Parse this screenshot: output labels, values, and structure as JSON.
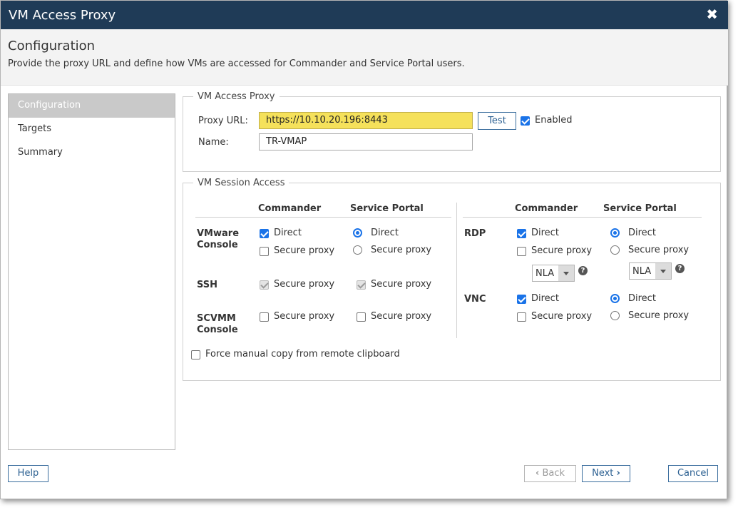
{
  "window": {
    "title": "VM Access Proxy",
    "close_icon": "✖"
  },
  "header": {
    "title": "Configuration",
    "description": "Provide the proxy URL and define how VMs are accessed for Commander and Service Portal users."
  },
  "nav": {
    "items": [
      {
        "label": "Configuration",
        "active": true
      },
      {
        "label": "Targets",
        "active": false
      },
      {
        "label": "Summary",
        "active": false
      }
    ]
  },
  "proxy": {
    "legend": "VM Access Proxy",
    "url_label": "Proxy URL:",
    "url_value": "https://10.10.20.196:8443",
    "test_label": "Test",
    "enabled_label": "Enabled",
    "enabled_checked": true,
    "name_label": "Name:",
    "name_value": "TR-VMAP"
  },
  "session": {
    "legend": "VM Session Access",
    "left": {
      "col_commander": "Commander",
      "col_portal": "Service Portal",
      "vmware_label": "VMware Console",
      "vmware_commander_direct": "Direct",
      "vmware_commander_secure": "Secure proxy",
      "vmware_portal_direct": "Direct",
      "vmware_portal_secure": "Secure proxy",
      "ssh_label": "SSH",
      "ssh_commander_secure": "Secure proxy",
      "ssh_portal_secure": "Secure proxy",
      "scvmm_label": "SCVMM Console",
      "scvmm_commander_secure": "Secure proxy",
      "scvmm_portal_secure": "Secure proxy"
    },
    "right": {
      "col_commander": "Commander",
      "col_portal": "Service Portal",
      "rdp_label": "RDP",
      "rdp_commander_direct": "Direct",
      "rdp_commander_secure": "Secure proxy",
      "rdp_commander_select": "NLA",
      "rdp_portal_direct": "Direct",
      "rdp_portal_secure": "Secure proxy",
      "rdp_portal_select": "NLA",
      "vnc_label": "VNC",
      "vnc_commander_direct": "Direct",
      "vnc_commander_secure": "Secure proxy",
      "vnc_portal_direct": "Direct",
      "vnc_portal_secure": "Secure proxy"
    },
    "clipboard_label": "Force manual copy from remote clipboard",
    "help_glyph": "?"
  },
  "footer": {
    "help_label": "Help",
    "back_label": "Back",
    "back_icon": "‹",
    "next_label": "Next",
    "next_icon": "›",
    "cancel_label": "Cancel"
  },
  "colors": {
    "titlebar": "#1f3b57",
    "accent": "#1a73e8",
    "highlight": "#f5e15b",
    "button_text": "#2a5f91"
  }
}
